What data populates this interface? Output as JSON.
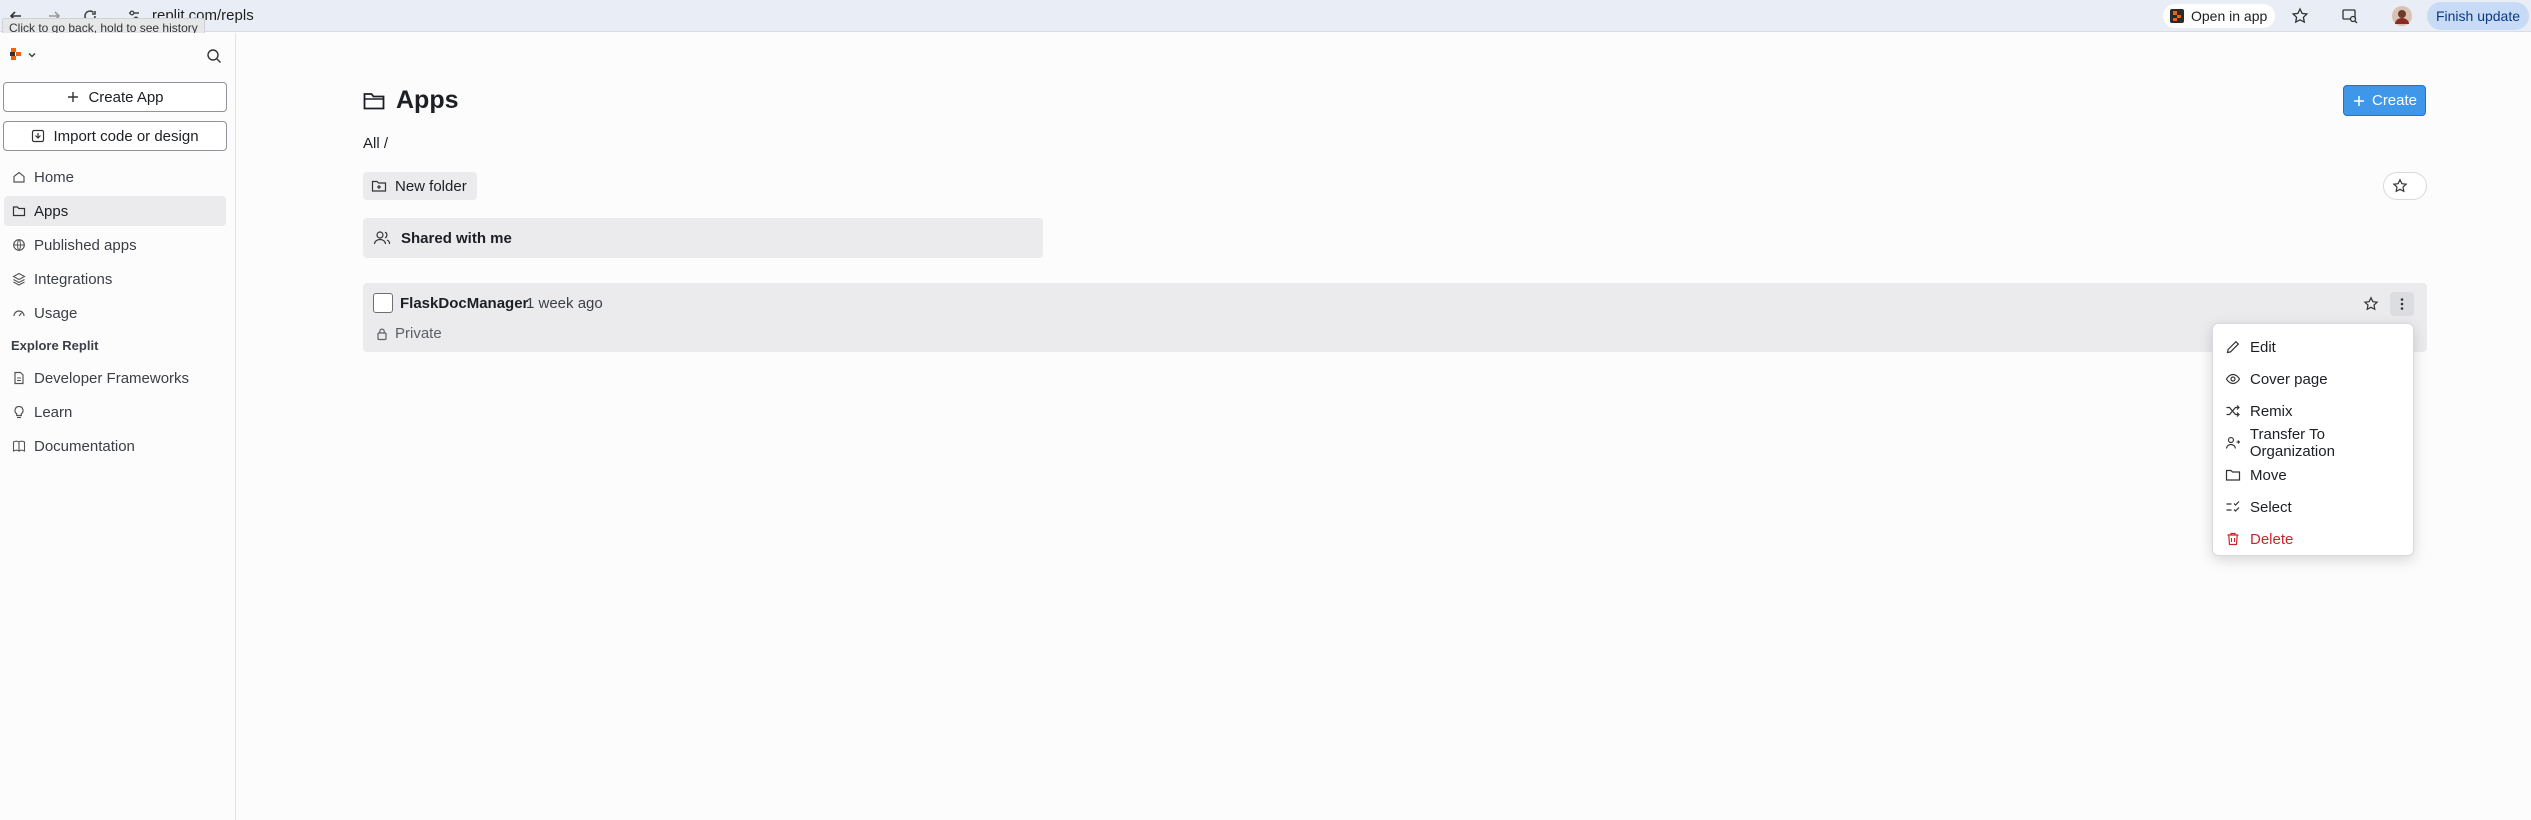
{
  "browser": {
    "url": "replit.com/repls",
    "tooltip": "Click to go back, hold to see history",
    "open_in_app_label": "Open in app",
    "finish_update_label": "Finish update"
  },
  "sidebar": {
    "create_app_label": "Create App",
    "import_label": "Import code or design",
    "nav_items": [
      {
        "label": "Home",
        "icon": "home-icon"
      },
      {
        "label": "Apps",
        "icon": "folder-icon",
        "active": true
      },
      {
        "label": "Published apps",
        "icon": "globe-icon"
      },
      {
        "label": "Integrations",
        "icon": "layers-icon"
      },
      {
        "label": "Usage",
        "icon": "gauge-icon"
      }
    ],
    "explore_section_label": "Explore Replit",
    "explore_items": [
      {
        "label": "Developer Frameworks",
        "icon": "file-icon"
      },
      {
        "label": "Learn",
        "icon": "lightbulb-icon"
      },
      {
        "label": "Documentation",
        "icon": "book-icon"
      }
    ]
  },
  "main": {
    "title": "Apps",
    "create_label": "Create",
    "breadcrumb": "All /",
    "new_folder_label": "New folder",
    "shared_label": "Shared with me",
    "repl": {
      "name": "FlaskDocManager",
      "updated": "1 week ago",
      "privacy": "Private"
    }
  },
  "context_menu": {
    "items": [
      {
        "label": "Edit",
        "icon": "pencil-icon"
      },
      {
        "label": "Cover page",
        "icon": "eye-icon"
      },
      {
        "label": "Remix",
        "icon": "shuffle-icon"
      },
      {
        "label": "Transfer To Organization",
        "icon": "user-transfer-icon"
      },
      {
        "label": "Move",
        "icon": "folder-icon"
      },
      {
        "label": "Select",
        "icon": "checklist-icon"
      },
      {
        "label": "Delete",
        "icon": "trash-icon",
        "danger": true
      }
    ]
  },
  "colors": {
    "accent": "#3f97e9",
    "danger": "#c9252d",
    "active_bg": "#ebebed"
  }
}
